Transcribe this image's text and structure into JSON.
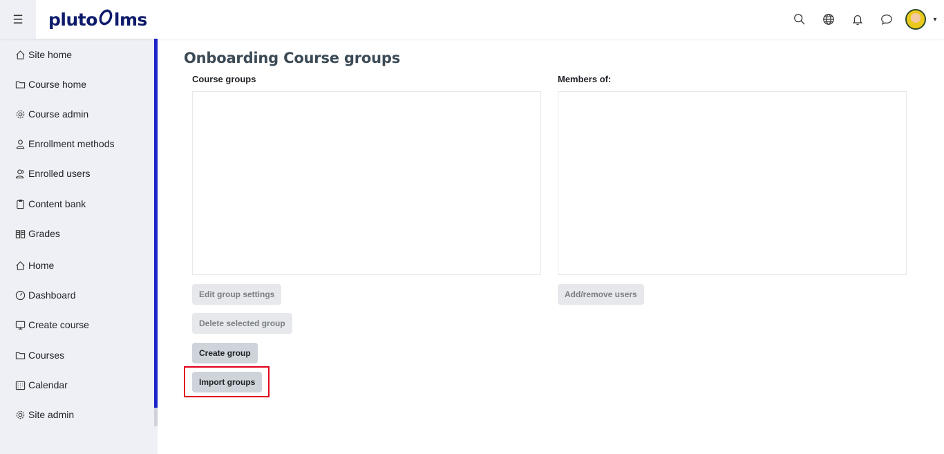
{
  "app": {
    "brand": "pluto",
    "brand_suffix": "lms"
  },
  "navbar": {
    "menu_icon": "hamburger-icon",
    "icons": [
      "search-icon",
      "globe-icon",
      "bell-icon",
      "chat-icon"
    ],
    "avatar": "user-avatar",
    "caret": "▾"
  },
  "sidebar": {
    "items": [
      {
        "label": "Site home",
        "icon": "home-icon"
      },
      {
        "label": "Course home",
        "icon": "folder-icon"
      },
      {
        "label": "Course admin",
        "icon": "gear-icon"
      },
      {
        "label": "Enrollment methods",
        "icon": "user-icon"
      },
      {
        "label": "Enrolled users",
        "icon": "users-icon"
      },
      {
        "label": "Content bank",
        "icon": "clipboard-icon"
      },
      {
        "label": "Grades",
        "icon": "book-icon"
      },
      {
        "label": "Home",
        "icon": "home-icon"
      },
      {
        "label": "Dashboard",
        "icon": "gauge-icon"
      },
      {
        "label": "Create course",
        "icon": "monitor-icon"
      },
      {
        "label": "Courses",
        "icon": "folder-icon"
      },
      {
        "label": "Calendar",
        "icon": "calendar-icon"
      },
      {
        "label": "Site admin",
        "icon": "gear-icon"
      }
    ]
  },
  "main": {
    "title": "Onboarding Course groups",
    "groups_label": "Course groups",
    "members_label": "Members of:",
    "buttons": {
      "edit_group": "Edit group settings",
      "delete_group": "Delete selected group",
      "create_group": "Create group",
      "import_groups": "Import groups",
      "add_remove_users": "Add/remove users"
    }
  },
  "colors": {
    "brand": "#0e1b6b",
    "accent_bar": "#1a24c8",
    "highlight": "#e0001b"
  }
}
